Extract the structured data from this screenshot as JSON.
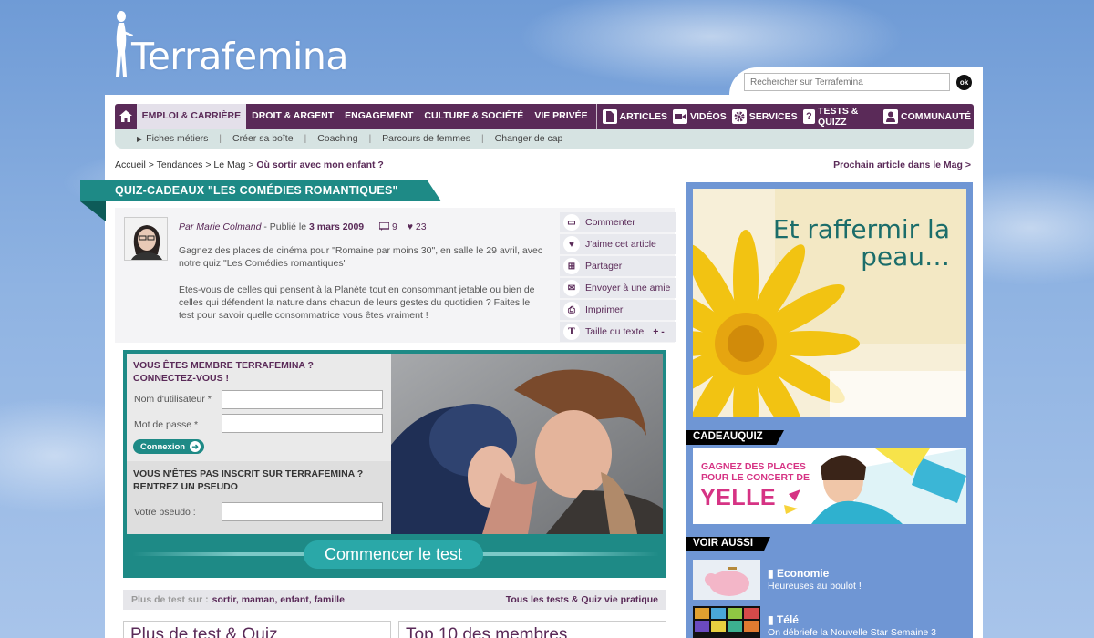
{
  "logo": {
    "text": "Terrafemina"
  },
  "search": {
    "placeholder": "Rechercher sur Terrafemina",
    "ok": "ok"
  },
  "nav": {
    "items": [
      "EMPLOI & CARRIÈRE",
      "DROIT & ARGENT",
      "ENGAGEMENT",
      "CULTURE & SOCIÉTÉ",
      "VIE PRIVÉE"
    ],
    "sections": [
      "ARTICLES",
      "VIDÉOS",
      "SERVICES",
      "TESTS & QUIZZ",
      "COMMUNAUTÉ"
    ]
  },
  "subnav": {
    "items": [
      "Fiches métiers",
      "Créer sa boîte",
      "Coaching",
      "Parcours de femmes",
      "Changer de cap"
    ]
  },
  "breadcrumb": {
    "trail": "Accueil > Tendances > Le Mag > ",
    "current": "Où sortir avec mon enfant ?"
  },
  "next_article": "Prochain article dans le Mag  >",
  "page_title": "QUIZ-CADEAUX \"LES COMÉDIES ROMANTIQUES\"",
  "article": {
    "author": "Par Marie Colmand",
    "published": " - Publié le ",
    "date": "3 mars 2009",
    "comments": "9",
    "likes": "23",
    "intro": "Gagnez des places de cinéma pour \"Romaine par moins 30\", en salle le 29 avril, avec notre quiz \"Les Comédies romantiques\"",
    "body": "Etes-vous de celles qui pensent à la Planète tout en consommant jetable ou bien de celles qui défendent la nature dans chacun de leurs gestes du quotidien ? Faites le test pour savoir quelle consommatrice vous êtes vraiment !"
  },
  "tools": {
    "comment": "Commenter",
    "like": "J'aime cet article",
    "share": "Partager",
    "send": "Envoyer à une amie",
    "print": "Imprimer",
    "size": "Taille du texte",
    "size_ctrl": "+ -"
  },
  "login": {
    "member_title": "VOUS ÊTES MEMBRE TERRAFEMINA ?",
    "member_sub": "CONNECTEZ-VOUS !",
    "username_label": "Nom d'utilisateur *",
    "password_label": "Mot de passe *",
    "connect_button": "Connexion",
    "guest_title": "VOUS N'ÊTES PAS INSCRIT SUR TERRAFEMINA ?",
    "guest_sub": "RENTREZ UN PSEUDO",
    "pseudo_label": "Votre pseudo :"
  },
  "start_button": "Commencer le test",
  "tags": {
    "label": "Plus de test sur :",
    "values": "sortir, maman, enfant, famille",
    "all_link": "Tous les tests & Quiz vie pratique"
  },
  "bottom_boxes": {
    "left": "Plus de test & Quiz",
    "right": "Top 10 des membres"
  },
  "ads": {
    "ad1_text": "Et raffermir la peau…",
    "cadeauquiz_label": "CADEAUQUIZ",
    "ad2_line1": "GAGNEZ DES PLACES",
    "ad2_line2": "POUR LE CONCERT DE",
    "ad2_name": "YELLE"
  },
  "voir_aussi": {
    "label": "VOIR AUSSI",
    "items": [
      {
        "category": "Economie",
        "title": "Heureuses au boulot !"
      },
      {
        "category": "Télé",
        "title": "On débriefe la Nouvelle Star Semaine 3"
      }
    ]
  },
  "colors": {
    "accent": "#5a2a58",
    "teal": "#1e8a86",
    "pink": "#d63384"
  }
}
